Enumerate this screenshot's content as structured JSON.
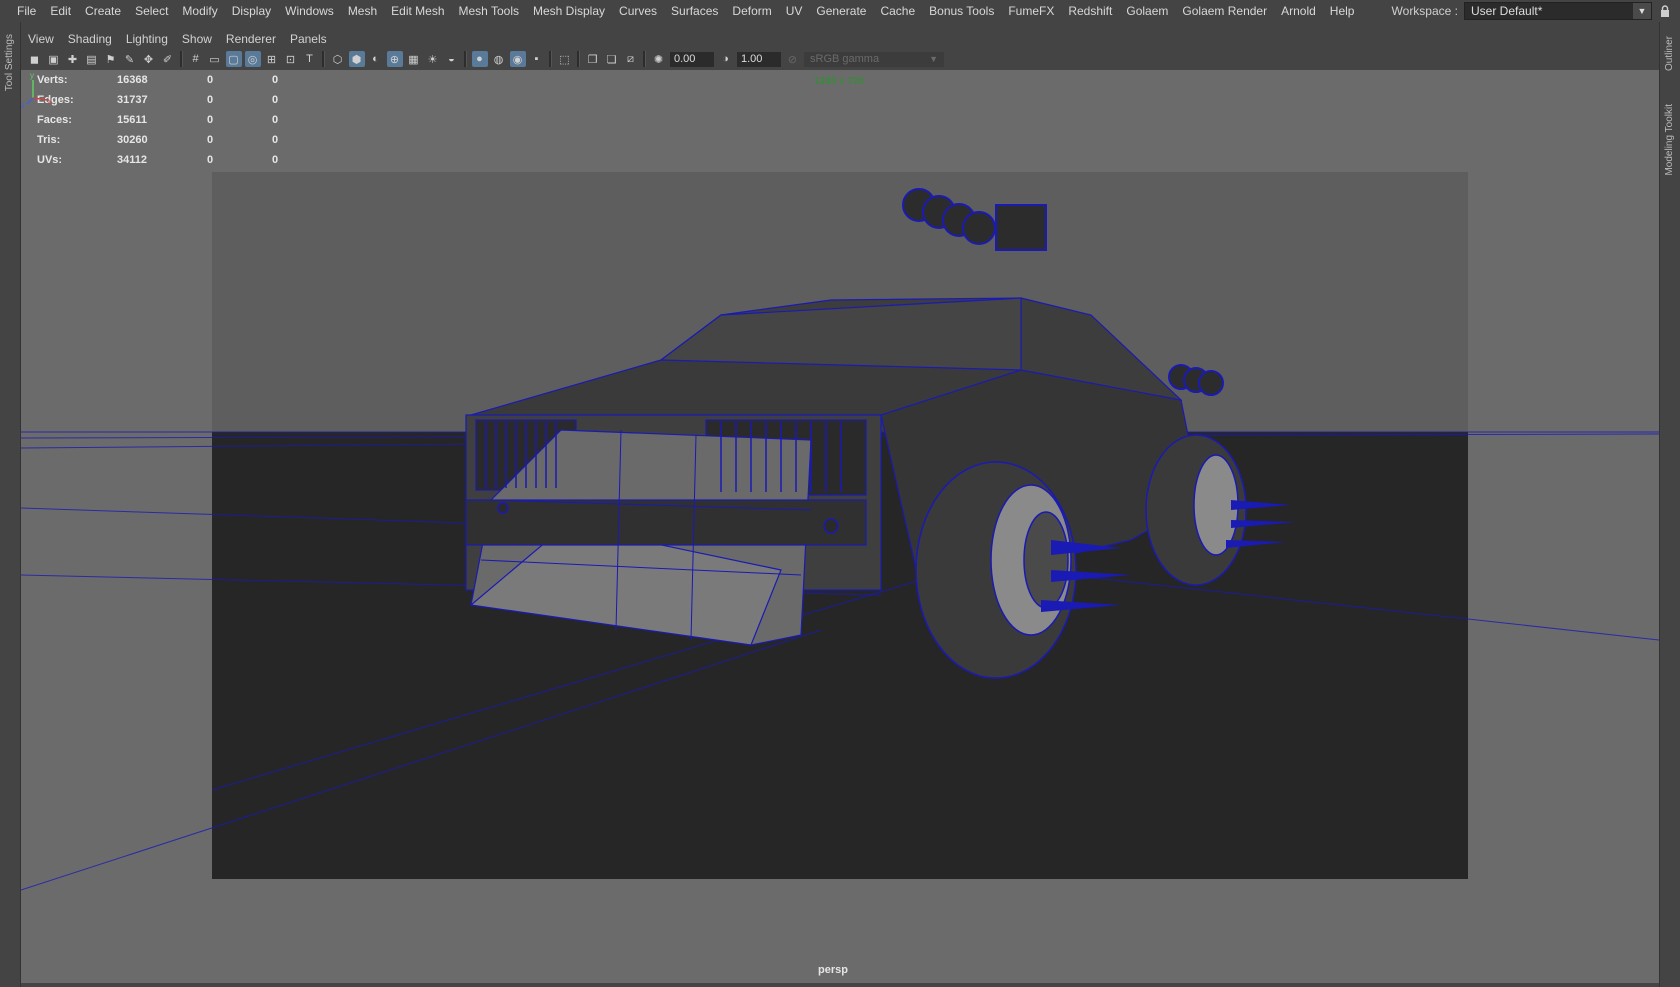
{
  "menubar": {
    "items": [
      "File",
      "Edit",
      "Create",
      "Select",
      "Modify",
      "Display",
      "Windows",
      "Mesh",
      "Edit Mesh",
      "Mesh Tools",
      "Mesh Display",
      "Curves",
      "Surfaces",
      "Deform",
      "UV",
      "Generate",
      "Cache",
      "Bonus Tools",
      "FumeFX",
      "Redshift",
      "Golaem",
      "Golaem Render",
      "Arnold",
      "Help"
    ]
  },
  "workspace": {
    "label": "Workspace :",
    "value": "User Default*"
  },
  "left_tabs": {
    "tool_settings": "Tool Settings"
  },
  "right_tabs": {
    "outliner": "Outliner",
    "modeling_toolkit": "Modeling Toolkit"
  },
  "panel_menu": {
    "items": [
      "View",
      "Shading",
      "Lighting",
      "Show",
      "Renderer",
      "Panels"
    ]
  },
  "toolbar": {
    "exposure": "0.00",
    "gamma": "1.00",
    "color_space": "sRGB gamma"
  },
  "hud": {
    "rows": [
      {
        "label": "Verts:",
        "value": "16368",
        "sel": "0",
        "comp": "0"
      },
      {
        "label": "Edges:",
        "value": "31737",
        "sel": "0",
        "comp": "0"
      },
      {
        "label": "Faces:",
        "value": "15611",
        "sel": "0",
        "comp": "0"
      },
      {
        "label": "Tris:",
        "value": "30260",
        "sel": "0",
        "comp": "0"
      },
      {
        "label": "UVs:",
        "value": "34112",
        "sel": "0",
        "comp": "0"
      }
    ],
    "resolution": "1280 x 720",
    "camera": "persp"
  },
  "colors": {
    "wireframe": "#1a1ab4",
    "viewport_bg": "#6b6b6b",
    "ground": "#252525",
    "hud_resolution": "#3b8a3b"
  }
}
